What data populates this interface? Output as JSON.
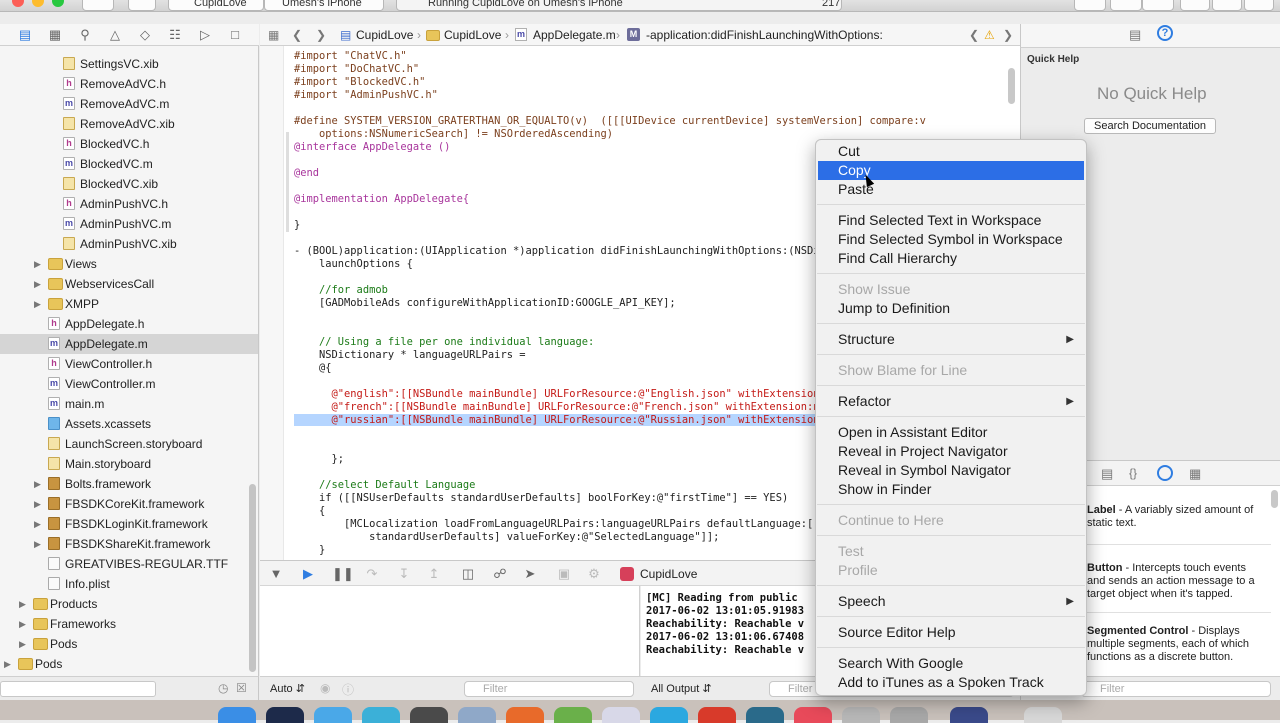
{
  "toolbar": {
    "scheme": "CupidLove",
    "device": "Umesh's iPhone",
    "status": "Running CupidLove on Umesh's iPhone",
    "warnings": "217"
  },
  "navigator": {
    "files": [
      {
        "name": "SettingsVC.xib",
        "kind": "xib",
        "indent": 1
      },
      {
        "name": "RemoveAdVC.h",
        "kind": "h",
        "indent": 1
      },
      {
        "name": "RemoveAdVC.m",
        "kind": "m",
        "indent": 1
      },
      {
        "name": "RemoveAdVC.xib",
        "kind": "xib",
        "indent": 1
      },
      {
        "name": "BlockedVC.h",
        "kind": "h",
        "indent": 1
      },
      {
        "name": "BlockedVC.m",
        "kind": "m",
        "indent": 1
      },
      {
        "name": "BlockedVC.xib",
        "kind": "xib",
        "indent": 1
      },
      {
        "name": "AdminPushVC.h",
        "kind": "h",
        "indent": 1
      },
      {
        "name": "AdminPushVC.m",
        "kind": "m",
        "indent": 1
      },
      {
        "name": "AdminPushVC.xib",
        "kind": "xib",
        "indent": 1
      },
      {
        "name": "Views",
        "kind": "folder",
        "indent": 0
      },
      {
        "name": "WebservicesCall",
        "kind": "folder",
        "indent": 0
      },
      {
        "name": "XMPP",
        "kind": "folder",
        "indent": 0
      },
      {
        "name": "AppDelegate.h",
        "kind": "h",
        "indent": 0
      },
      {
        "name": "AppDelegate.m",
        "kind": "m",
        "indent": 0,
        "selected": true
      },
      {
        "name": "ViewController.h",
        "kind": "h",
        "indent": 0
      },
      {
        "name": "ViewController.m",
        "kind": "m",
        "indent": 0
      },
      {
        "name": "main.m",
        "kind": "m",
        "indent": 0
      },
      {
        "name": "Assets.xcassets",
        "kind": "xc",
        "indent": 0
      },
      {
        "name": "LaunchScreen.storyboard",
        "kind": "sb",
        "indent": 0
      },
      {
        "name": "Main.storyboard",
        "kind": "sb",
        "indent": 0
      },
      {
        "name": "Bolts.framework",
        "kind": "fw",
        "indent": 0
      },
      {
        "name": "FBSDKCoreKit.framework",
        "kind": "fw",
        "indent": 0
      },
      {
        "name": "FBSDKLoginKit.framework",
        "kind": "fw",
        "indent": 0
      },
      {
        "name": "FBSDKShareKit.framework",
        "kind": "fw",
        "indent": 0
      },
      {
        "name": "GREATVIBES-REGULAR.TTF",
        "kind": "doc",
        "indent": 0
      },
      {
        "name": "Info.plist",
        "kind": "doc",
        "indent": 0
      },
      {
        "name": "Products",
        "kind": "folder",
        "indent": -1
      },
      {
        "name": "Frameworks",
        "kind": "folder",
        "indent": -1
      },
      {
        "name": "Pods",
        "kind": "folder",
        "indent": -1
      },
      {
        "name": "Pods",
        "kind": "folder",
        "indent": -2
      }
    ]
  },
  "jumpbar": {
    "project": "CupidLove",
    "group": "CupidLove",
    "file": "AppDelegate.m",
    "method": "-application:didFinishLaunchingWithOptions:"
  },
  "editor": {
    "lines": [
      "#import \"ChatVC.h\"",
      "#import \"DoChatVC.h\"",
      "#import \"BlockedVC.h\"",
      "#import \"AdminPushVC.h\"",
      "#define SYSTEM_VERSION_GRATERTHAN_OR_EQUALTO(v)  ([[[UIDevice currentDevice] systemVersion] compare:v",
      "    options:NSNumericSearch] != NSOrderedAscending)",
      "@interface AppDelegate ()",
      "@end",
      "@implementation AppDelegate{",
      "}",
      "- (BOOL)application:(UIApplication *)application didFinishLaunchingWithOptions:(NSDictionary *)",
      "    launchOptions {",
      "    //for admob",
      "    [GADMobileAds configureWithApplicationID:GOOGLE_API_KEY];",
      "    // Using a file per one individual language:",
      "    NSDictionary * languageURLPairs =",
      "    @{",
      "      @\"english\":[[NSBundle mainBundle] URLForResource:@\"English.json\" withExtension:nil],",
      "      @\"french\":[[NSBundle mainBundle] URLForResource:@\"French.json\" withExtension:nil],",
      "      @\"russian\":[[NSBundle mainBundle] URLForResource:@\"Russian.json\" withExtension:nil],",
      "      };",
      "    //select Default Language",
      "    if ([[NSUserDefaults standardUserDefaults] boolForKey:@\"firstTime\"] == YES)",
      "    {",
      "        [MCLocalization loadFromLanguageURLPairs:languageURLPairs defaultLanguage:[[NSUserDefaults",
      "            standardUserDefaults] valueForKey:@\"SelectedLanguage\"]];",
      "    }"
    ]
  },
  "debug": {
    "target": "CupidLove",
    "var_filter_mode": "Auto",
    "filter_placeholder": "Filter",
    "output_mode": "All Output",
    "console_lines": [
      "[MC] Reading from public",
      "2017-06-02 13:01:05.91983",
      "Reachability: Reachable v",
      "2017-06-02 13:01:06.67408",
      "Reachability: Reachable v"
    ]
  },
  "inspector": {
    "title": "Quick Help",
    "no_help": "No Quick Help",
    "search_docs": "Search Documentation",
    "library": [
      {
        "name": "Label",
        "desc": " - A variably sized amount of static text."
      },
      {
        "name": "Button",
        "desc": " - Intercepts touch events and sends an action message to a target object when it's tapped."
      },
      {
        "name": "Segmented Control",
        "desc": " - Displays multiple segments, each of which functions as a discrete button."
      }
    ]
  },
  "context_menu": {
    "groups": [
      [
        {
          "label": "Cut",
          "enabled": true
        },
        {
          "label": "Copy",
          "enabled": true,
          "highlighted": true
        },
        {
          "label": "Paste",
          "enabled": true
        }
      ],
      [
        {
          "label": "Find Selected Text in Workspace",
          "enabled": true
        },
        {
          "label": "Find Selected Symbol in Workspace",
          "enabled": true
        },
        {
          "label": "Find Call Hierarchy",
          "enabled": true
        }
      ],
      [
        {
          "label": "Show Issue",
          "enabled": false
        },
        {
          "label": "Jump to Definition",
          "enabled": true
        }
      ],
      [
        {
          "label": "Structure",
          "enabled": true,
          "submenu": true
        }
      ],
      [
        {
          "label": "Show Blame for Line",
          "enabled": false
        }
      ],
      [
        {
          "label": "Refactor",
          "enabled": true,
          "submenu": true
        }
      ],
      [
        {
          "label": "Open in Assistant Editor",
          "enabled": true
        },
        {
          "label": "Reveal in Project Navigator",
          "enabled": true
        },
        {
          "label": "Reveal in Symbol Navigator",
          "enabled": true
        },
        {
          "label": "Show in Finder",
          "enabled": true
        }
      ],
      [
        {
          "label": "Continue to Here",
          "enabled": false
        }
      ],
      [
        {
          "label": "Test",
          "enabled": false
        },
        {
          "label": "Profile",
          "enabled": false
        }
      ],
      [
        {
          "label": "Speech",
          "enabled": true,
          "submenu": true
        }
      ],
      [
        {
          "label": "Source Editor Help",
          "enabled": true
        }
      ],
      [
        {
          "label": "Search With Google",
          "enabled": true
        },
        {
          "label": "Add to iTunes as a Spoken Track",
          "enabled": true
        }
      ]
    ]
  },
  "colors": {
    "menu_highlight": "#2c6ee6",
    "folder": "#e8c55a",
    "selection": "#b5d5ff"
  }
}
